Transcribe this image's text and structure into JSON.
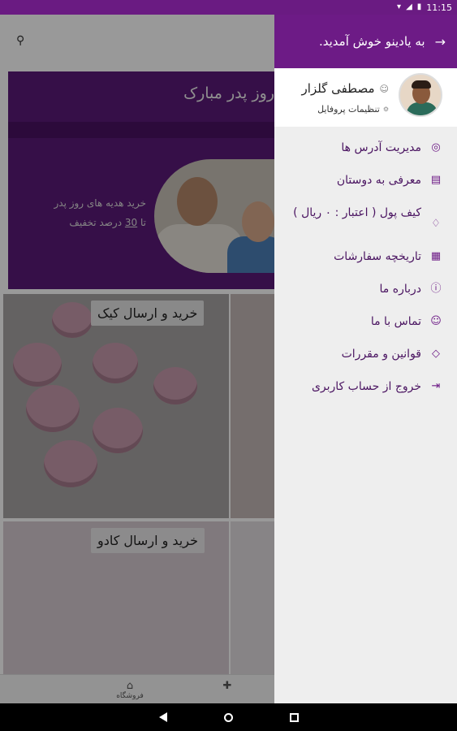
{
  "status_bar": {
    "time": "11:15",
    "icons": [
      "wifi-icon",
      "signal-icon",
      "battery-icon"
    ]
  },
  "background": {
    "banner": {
      "title": "روز پدر مبارک",
      "text_line1": "خرید هدیه های روز پدر",
      "text_prefix": "تا",
      "text_percent": "30",
      "text_suffix": "درصد تخفیف"
    },
    "cards": [
      {
        "label": "خرید و ارسال کیک"
      },
      {
        "label": "خرید و ارسال کادو"
      }
    ],
    "bottom_nav": [
      {
        "label": "فروشگاه",
        "icon": "store-icon"
      },
      {
        "label": "",
        "icon": "gift-icon"
      }
    ]
  },
  "drawer": {
    "header_title": "به یادینو خوش آمدید.",
    "back_icon": "arrow-right-icon",
    "profile": {
      "name": "مصطفی گلزار",
      "settings_label": "تنظیمات پروفایل"
    },
    "menu": [
      {
        "label": "مدیریت آدرس ها",
        "icon": "location-icon"
      },
      {
        "label": "معرفی به دوستان",
        "icon": "share-icon"
      },
      {
        "label": "کیف پول ( اعتبار : ۰ ریال )",
        "icon": "wallet-icon"
      },
      {
        "label": "تاریخچه سفارشات",
        "icon": "history-icon"
      },
      {
        "label": "درباره ما",
        "icon": "info-icon"
      },
      {
        "label": "تماس با ما",
        "icon": "contact-icon"
      },
      {
        "label": "قوانین و مقررات",
        "icon": "rules-icon"
      },
      {
        "label": "خروج از حساب کاربری",
        "icon": "logout-icon"
      }
    ]
  },
  "colors": {
    "primary": "#6d1b86",
    "status_bar": "#6a1b82",
    "drawer_bg": "#eeeeee"
  }
}
